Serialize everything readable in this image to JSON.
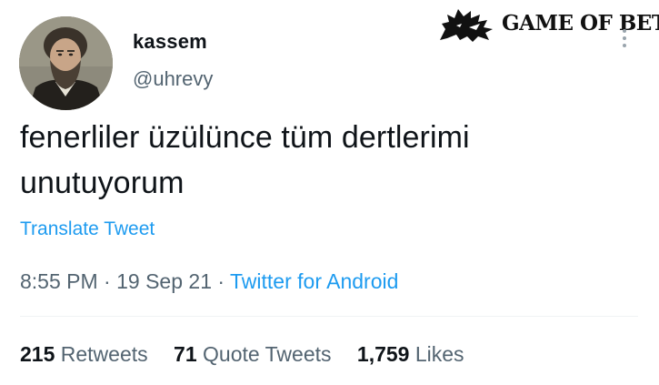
{
  "user": {
    "display_name": "kassem",
    "handle": "@uhrevy"
  },
  "tweet": {
    "text_line1": "fenerliler üzülünce tüm dertlerimi",
    "text_line2": "unutuyorum",
    "translate_label": "Translate Tweet",
    "time": "8:55 PM",
    "date": "19 Sep 21",
    "source": "Twitter for Android",
    "separator": "·"
  },
  "stats": {
    "retweets_count": "215",
    "retweets_label": "Retweets",
    "quotes_count": "71",
    "quotes_label": "Quote Tweets",
    "likes_count": "1,759",
    "likes_label": "Likes"
  },
  "watermark": {
    "text": "GAME OF BET",
    "icon": "wolf-sigil-icon"
  },
  "icons": {
    "more": "more-options-icon"
  },
  "colors": {
    "link": "#1d9bf0",
    "secondary": "#536471",
    "primary": "#0f1419"
  }
}
